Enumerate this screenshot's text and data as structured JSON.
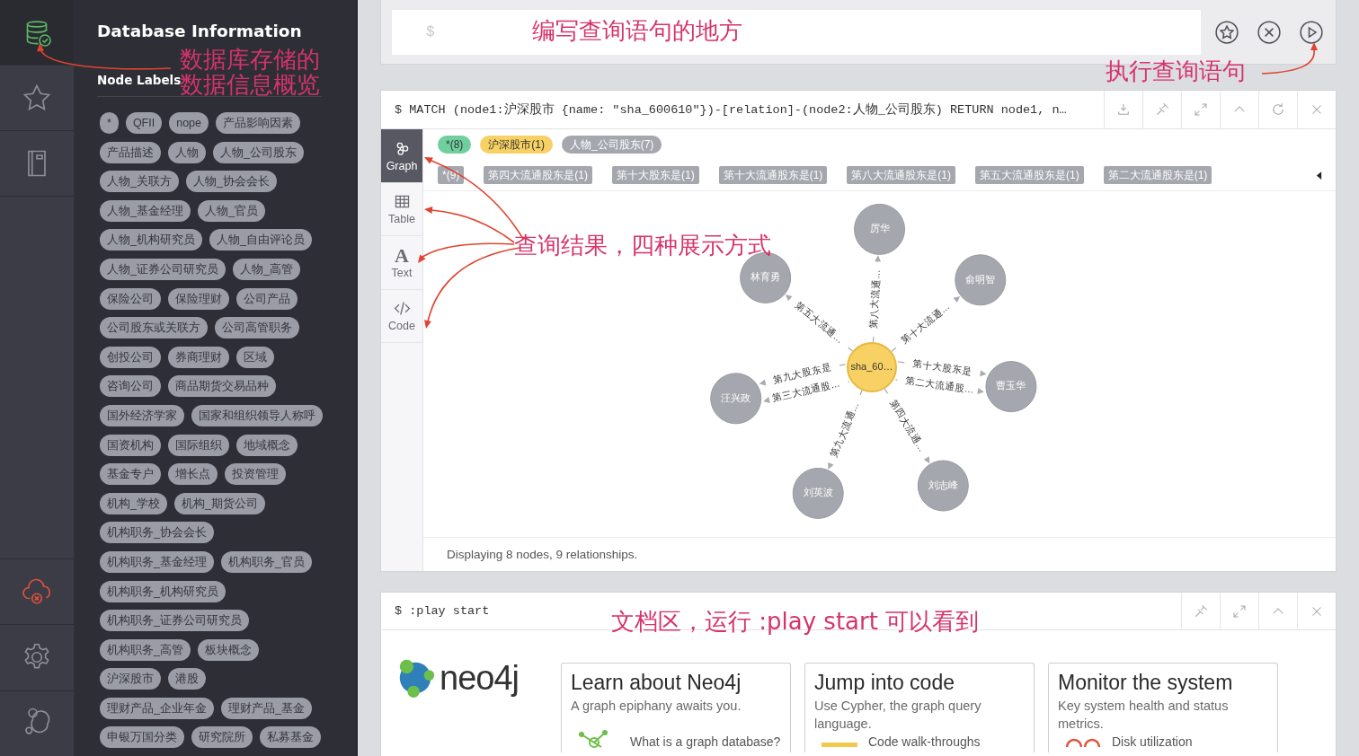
{
  "nav_rail": {
    "top_items": [
      {
        "kind": "database",
        "selected": true
      },
      {
        "kind": "favorites",
        "selected": false
      },
      {
        "kind": "documents",
        "selected": false
      }
    ],
    "bottom_items": [
      {
        "kind": "cloud_error",
        "selected": false
      },
      {
        "kind": "settings",
        "selected": false
      },
      {
        "kind": "about",
        "selected": false
      }
    ]
  },
  "sidebar": {
    "title": "Database Information",
    "section": "Node Labels",
    "labels": [
      "*",
      "QFII",
      "nope",
      "产品影响因素",
      "产品描述",
      "人物",
      "人物_公司股东",
      "人物_关联方",
      "人物_协会会长",
      "人物_基金经理",
      "人物_官员",
      "人物_机构研究员",
      "人物_自由评论员",
      "人物_证券公司研究员",
      "人物_高管",
      "保险公司",
      "保险理财",
      "公司产品",
      "公司股东或关联方",
      "公司高管职务",
      "创投公司",
      "券商理财",
      "区域",
      "咨询公司",
      "商品期货交易品种",
      "国外经济学家",
      "国家和组织领导人称呼",
      "国资机构",
      "国际组织",
      "地域概念",
      "基金专户",
      "增长点",
      "投资管理",
      "机构_学校",
      "机构_期货公司",
      "机构职务_协会会长",
      "机构职务_基金经理",
      "机构职务_官员",
      "机构职务_机构研究员",
      "机构职务_证券公司研究员",
      "机构职务_高管",
      "板块概念",
      "沪深股市",
      "港股",
      "理财产品_企业年金",
      "理财产品_基金",
      "申银万国分类",
      "研究院所",
      "私募基金"
    ]
  },
  "editor": {
    "placeholder": "$",
    "buttons": [
      {
        "kind": "favorite"
      },
      {
        "kind": "clear"
      },
      {
        "kind": "run"
      }
    ]
  },
  "result": {
    "query": "$ MATCH (node1:沪深股市 {name: \"sha_600610\"})-[relation]-(node2:人物_公司股东) RETURN node1, n…",
    "actions": [
      {
        "kind": "download"
      },
      {
        "kind": "pin"
      },
      {
        "kind": "expand"
      },
      {
        "kind": "collapse"
      },
      {
        "kind": "rerun"
      },
      {
        "kind": "close"
      }
    ],
    "views": [
      {
        "kind": "graph",
        "label": "Graph",
        "selected": true
      },
      {
        "kind": "table",
        "label": "Table",
        "selected": false
      },
      {
        "kind": "text",
        "label": "Text",
        "glyph": "A",
        "selected": false
      },
      {
        "kind": "code",
        "label": "Code",
        "selected": false
      }
    ],
    "node_labels": [
      {
        "label": "*(8)",
        "color": "#6fd09e"
      },
      {
        "label": "沪深股市(1)",
        "color": "#f7d164"
      },
      {
        "label": "人物_公司股东(7)",
        "color": "#a5a7ae"
      }
    ],
    "relationship_types": [
      "*(9)",
      "第四大流通股东是(1)",
      "第十大股东是(1)",
      "第十大流通股东是(1)",
      "第八大流通股东是(1)",
      "第五大流通股东是(1)",
      "第二大流通股东是(1)"
    ],
    "graph": {
      "center": "sha_60…",
      "nodes": [
        {
          "name": "厉华",
          "relationships": [
            "第八大流通…"
          ]
        },
        {
          "name": "俞明智",
          "relationships": [
            "第十大流通…"
          ]
        },
        {
          "name": "曹玉华",
          "relationships": [
            "第十大股东是",
            "第二大流通股…"
          ]
        },
        {
          "name": "刘志峰",
          "relationships": [
            "第四大流通…"
          ]
        },
        {
          "name": "刘英波",
          "relationships": [
            "第九大流通…"
          ]
        },
        {
          "name": "汪兴政",
          "relationships": [
            "第三大流通股…",
            "第九大股东是"
          ]
        },
        {
          "name": "林育勇",
          "relationships": [
            "第五大流通…"
          ]
        }
      ]
    },
    "status": "Displaying 8 nodes, 9 relationships."
  },
  "guide": {
    "command": "$ :play start",
    "actions": [
      {
        "kind": "pin"
      },
      {
        "kind": "expand"
      },
      {
        "kind": "collapse"
      },
      {
        "kind": "close"
      }
    ],
    "logo": "neo4j",
    "cards": [
      {
        "kind": "graph",
        "title": "Learn about Neo4j",
        "subtitle": "A graph epiphany awaits you.",
        "item": "What is a graph database?"
      },
      {
        "kind": "code",
        "title": "Jump into code",
        "subtitle": "Use Cypher, the graph query language.",
        "item": "Code walk-throughs"
      },
      {
        "kind": "monitor",
        "title": "Monitor the system",
        "subtitle": "Key system health and status metrics.",
        "item": "Disk utilization"
      }
    ]
  },
  "annotations": [
    "数据库存储的",
    "数据信息概览",
    "编写查询语句的地方",
    "执行查询语句",
    "查询结果，四种展示方式",
    "文档区，运行 :play start 可以看到"
  ]
}
